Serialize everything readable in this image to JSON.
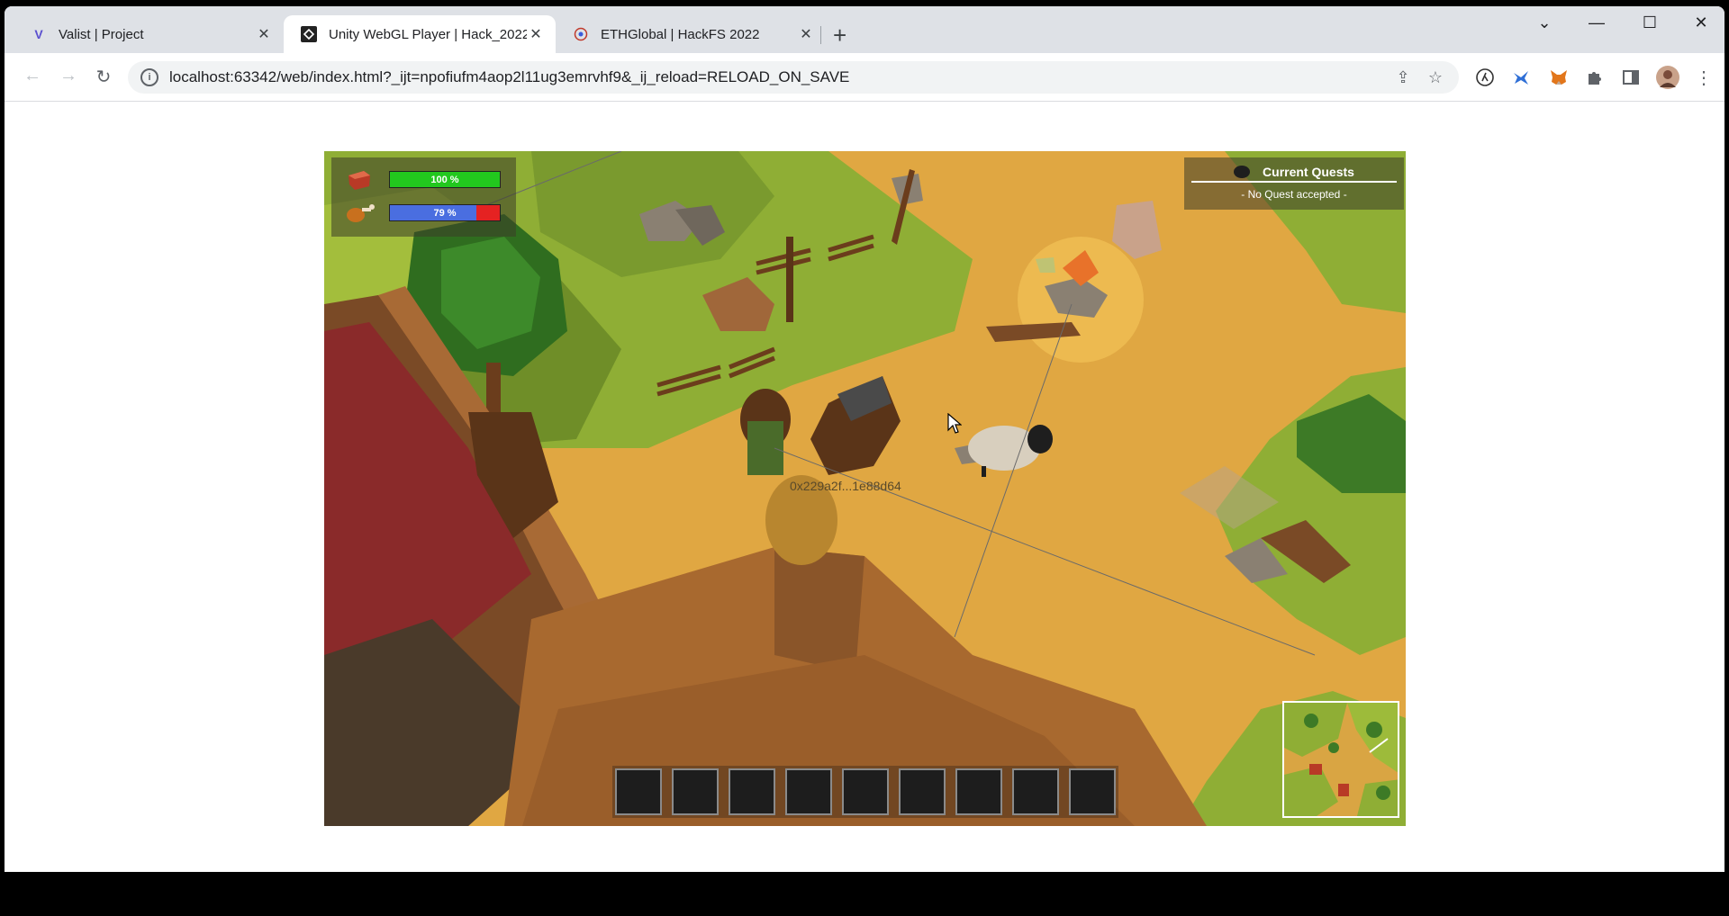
{
  "tabs": [
    {
      "title": "Valist | Project",
      "favicon": "valist-v-icon",
      "active": false
    },
    {
      "title": "Unity WebGL Player | Hack_2022",
      "favicon": "unity-icon",
      "active": true
    },
    {
      "title": "ETHGlobal | HackFS 2022",
      "favicon": "ethglobal-icon",
      "active": false
    }
  ],
  "toolbar": {
    "url": "localhost:63342/web/index.html?_ijt=npofiufm4aop2l11ug3emrvhf9&_ij_reload=RELOAD_ON_SAVE"
  },
  "game": {
    "health": {
      "label": "100 %",
      "value": 1.0,
      "color": "#22c81e"
    },
    "hunger": {
      "label": "79 %",
      "value": 0.79,
      "color": "#4a6ee0",
      "remaining_color": "#e52222"
    },
    "quests": {
      "title": "Current Quests",
      "status": "- No Quest accepted -"
    },
    "player_address": "0x229a2f...1e88d64",
    "hotbar_slots": 9
  },
  "colors": {
    "sand": "#e0a742",
    "grass": "#8fae35",
    "dark_grass": "#3d7a26",
    "wood": "#8a5529"
  }
}
